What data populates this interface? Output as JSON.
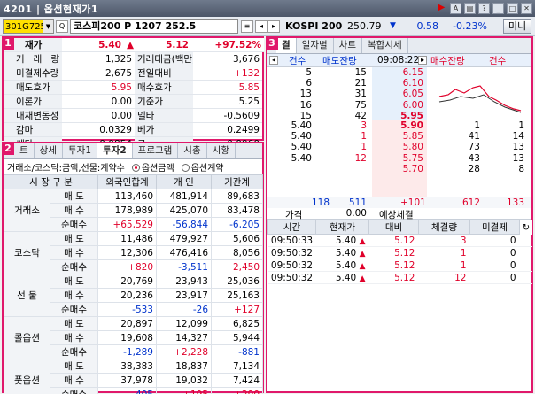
{
  "window": {
    "title": "4201 | 옵션현재가1"
  },
  "toolbar": {
    "code": "301G7252",
    "name": "코스피200 P 1207 252.5",
    "market_label": "KOSPI 200",
    "market_value": "250.79",
    "market_arrow": "▼",
    "market_change": "0.58",
    "market_pct": "-0.23%",
    "mini_label": "미니"
  },
  "panel1": {
    "badge": "1",
    "rows": [
      {
        "l1": "재가",
        "v1": "5.40",
        "arrow": "▲",
        "v1b": "5.12",
        "pct": "+97.52%"
      },
      {
        "l1": "거 래 량",
        "v1": "1,325",
        "l2": "거래대금(백만)",
        "v2": "3,676"
      },
      {
        "l1": "미결제수량",
        "v1": "2,675",
        "l2": "전일대비",
        "v2": "+132"
      },
      {
        "l1": "매도호가",
        "v1": "5.95",
        "l2": "매수호가",
        "v2": "5.85"
      },
      {
        "l1": "이론가",
        "v1": "0.00",
        "l2": "기준가",
        "v2": "5.25"
      },
      {
        "l1": "내재변동성",
        "v1": "0.00",
        "l2": "델타",
        "v2": "-0.5609"
      },
      {
        "l1": "감마",
        "v1": "0.0329",
        "l2": "베가",
        "v2": "0.2499"
      },
      {
        "l1": "쎄타",
        "v1": "-0.0854",
        "l2": "로",
        "v2": "-0.0960"
      }
    ]
  },
  "panel2": {
    "badge": "2",
    "tabs": [
      "트",
      "상세",
      "투자1",
      "투자2",
      "프로그램",
      "시총",
      "시황"
    ],
    "option_label": "거래소/코스닥:금액,선물:계약수",
    "radio1": "옵션금액",
    "radio2": "옵션계약",
    "headers": [
      "시 장 구 분",
      "외국인합계",
      "개 인",
      "기관계"
    ],
    "groups": [
      {
        "name": "거래소",
        "rows": [
          {
            "sub": "매 도",
            "a": "113,460",
            "b": "481,914",
            "c": "89,683"
          },
          {
            "sub": "매 수",
            "a": "178,989",
            "b": "425,070",
            "c": "83,478"
          },
          {
            "sub": "순매수",
            "a": "+65,529",
            "b": "-56,844",
            "c": "-6,205"
          }
        ]
      },
      {
        "name": "코스닥",
        "rows": [
          {
            "sub": "매 도",
            "a": "11,486",
            "b": "479,927",
            "c": "5,606"
          },
          {
            "sub": "매 수",
            "a": "12,306",
            "b": "476,416",
            "c": "8,056"
          },
          {
            "sub": "순매수",
            "a": "+820",
            "b": "-3,511",
            "c": "+2,450"
          }
        ]
      },
      {
        "name": "선 물",
        "rows": [
          {
            "sub": "매 도",
            "a": "20,769",
            "b": "23,943",
            "c": "25,036"
          },
          {
            "sub": "매 수",
            "a": "20,236",
            "b": "23,917",
            "c": "25,163"
          },
          {
            "sub": "순매수",
            "a": "-533",
            "b": "-26",
            "c": "+127"
          }
        ]
      },
      {
        "name": "콜옵션",
        "rows": [
          {
            "sub": "매 도",
            "a": "20,897",
            "b": "12,099",
            "c": "6,825"
          },
          {
            "sub": "매 수",
            "a": "19,608",
            "b": "14,327",
            "c": "5,944"
          },
          {
            "sub": "순매수",
            "a": "-1,289",
            "b": "+2,228",
            "c": "-881"
          }
        ]
      },
      {
        "name": "풋옵션",
        "rows": [
          {
            "sub": "매 도",
            "a": "38,383",
            "b": "18,837",
            "c": "7,134"
          },
          {
            "sub": "매 수",
            "a": "37,978",
            "b": "19,032",
            "c": "7,424"
          },
          {
            "sub": "순매수",
            "a": "-405",
            "b": "+195",
            "c": "+290"
          }
        ]
      }
    ]
  },
  "panel3": {
    "badge": "3",
    "tabs": [
      "결",
      "일자별",
      "차트",
      "복합시세"
    ],
    "ob_header": {
      "c1": "건수",
      "c2": "매도잔량",
      "time": "09:08:22",
      "c3": "매수잔량",
      "c4": "건수"
    },
    "asks": [
      {
        "cnt": "5",
        "qty": "15",
        "price": "6.15"
      },
      {
        "cnt": "6",
        "qty": "21",
        "price": "6.10"
      },
      {
        "cnt": "13",
        "qty": "31",
        "price": "6.05"
      },
      {
        "cnt": "16",
        "qty": "75",
        "price": "6.00"
      },
      {
        "cnt": "15",
        "qty": "42",
        "price": "5.95"
      }
    ],
    "bids": [
      {
        "price": "5.90",
        "qty": "1",
        "cnt": "1"
      },
      {
        "price": "5.85",
        "qty": "41",
        "cnt": "14"
      },
      {
        "price": "5.80",
        "qty": "73",
        "cnt": "13"
      },
      {
        "price": "5.75",
        "qty": "43",
        "cnt": "13"
      },
      {
        "price": "5.70",
        "qty": "28",
        "cnt": "8"
      }
    ],
    "trades_left": [
      {
        "p": "5.40",
        "q": "3"
      },
      {
        "p": "5.40",
        "q": "1"
      },
      {
        "p": "5.40",
        "q": "1"
      },
      {
        "p": "5.40",
        "q": "12"
      },
      {
        "p": "",
        "q": ""
      }
    ],
    "footer": {
      "ask_cnt": "118",
      "ask_qty": "511",
      "diff": "+101",
      "bid_qty": "612",
      "bid_cnt": "133"
    },
    "price_row": {
      "label": "가격",
      "value": "0.00",
      "exp_label": "예상체결"
    },
    "trade_headers": [
      "시간",
      "현재가",
      "대비",
      "체결량",
      "미결제"
    ],
    "trades": [
      {
        "time": "09:50:33",
        "price": "5.40",
        "arrow": "▲",
        "diff": "5.12",
        "qty": "3",
        "oi": "0"
      },
      {
        "time": "09:50:32",
        "price": "5.40",
        "arrow": "▲",
        "diff": "5.12",
        "qty": "1",
        "oi": "0"
      },
      {
        "time": "09:50:32",
        "price": "5.40",
        "arrow": "▲",
        "diff": "5.12",
        "qty": "1",
        "oi": "0"
      },
      {
        "time": "09:50:32",
        "price": "5.40",
        "arrow": "▲",
        "diff": "5.12",
        "qty": "12",
        "oi": "0"
      }
    ]
  }
}
